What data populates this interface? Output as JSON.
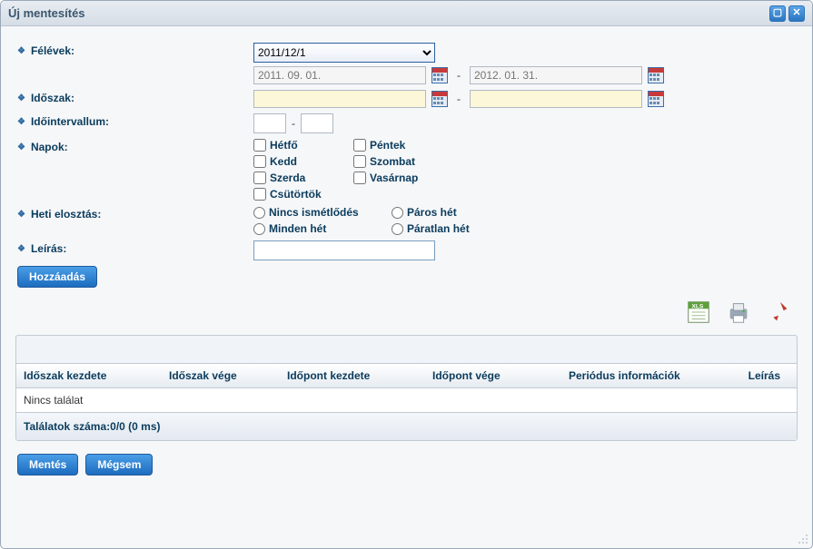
{
  "window": {
    "title": "Új mentesítés"
  },
  "labels": {
    "semesters": "Félévek:",
    "period": "Időszak:",
    "interval": "Időintervallum:",
    "days": "Napok:",
    "weekly": "Heti elosztás:",
    "description": "Leírás:"
  },
  "semester": {
    "selected": "2011/12/1",
    "start_placeholder": "2011. 09. 01.",
    "end_placeholder": "2012. 01. 31."
  },
  "interval": {
    "sep": "-"
  },
  "period_sep": "-",
  "days": {
    "mon": "Hétfő",
    "tue": "Kedd",
    "wed": "Szerda",
    "thu": "Csütörtök",
    "fri": "Péntek",
    "sat": "Szombat",
    "sun": "Vasárnap"
  },
  "weekly": {
    "none": "Nincs ismétlődés",
    "every": "Minden hét",
    "even": "Páros hét",
    "odd": "Páratlan hét"
  },
  "buttons": {
    "add": "Hozzáadás",
    "save": "Mentés",
    "cancel": "Mégsem"
  },
  "grid": {
    "headers": {
      "start_period": "Időszak kezdete",
      "end_period": "Időszak vége",
      "start_time": "Időpont kezdete",
      "end_time": "Időpont vége",
      "period_info": "Periódus információk",
      "desc": "Leírás"
    },
    "empty_text": "Nincs találat",
    "footer": "Találatok száma:0/0 (0 ms)"
  }
}
